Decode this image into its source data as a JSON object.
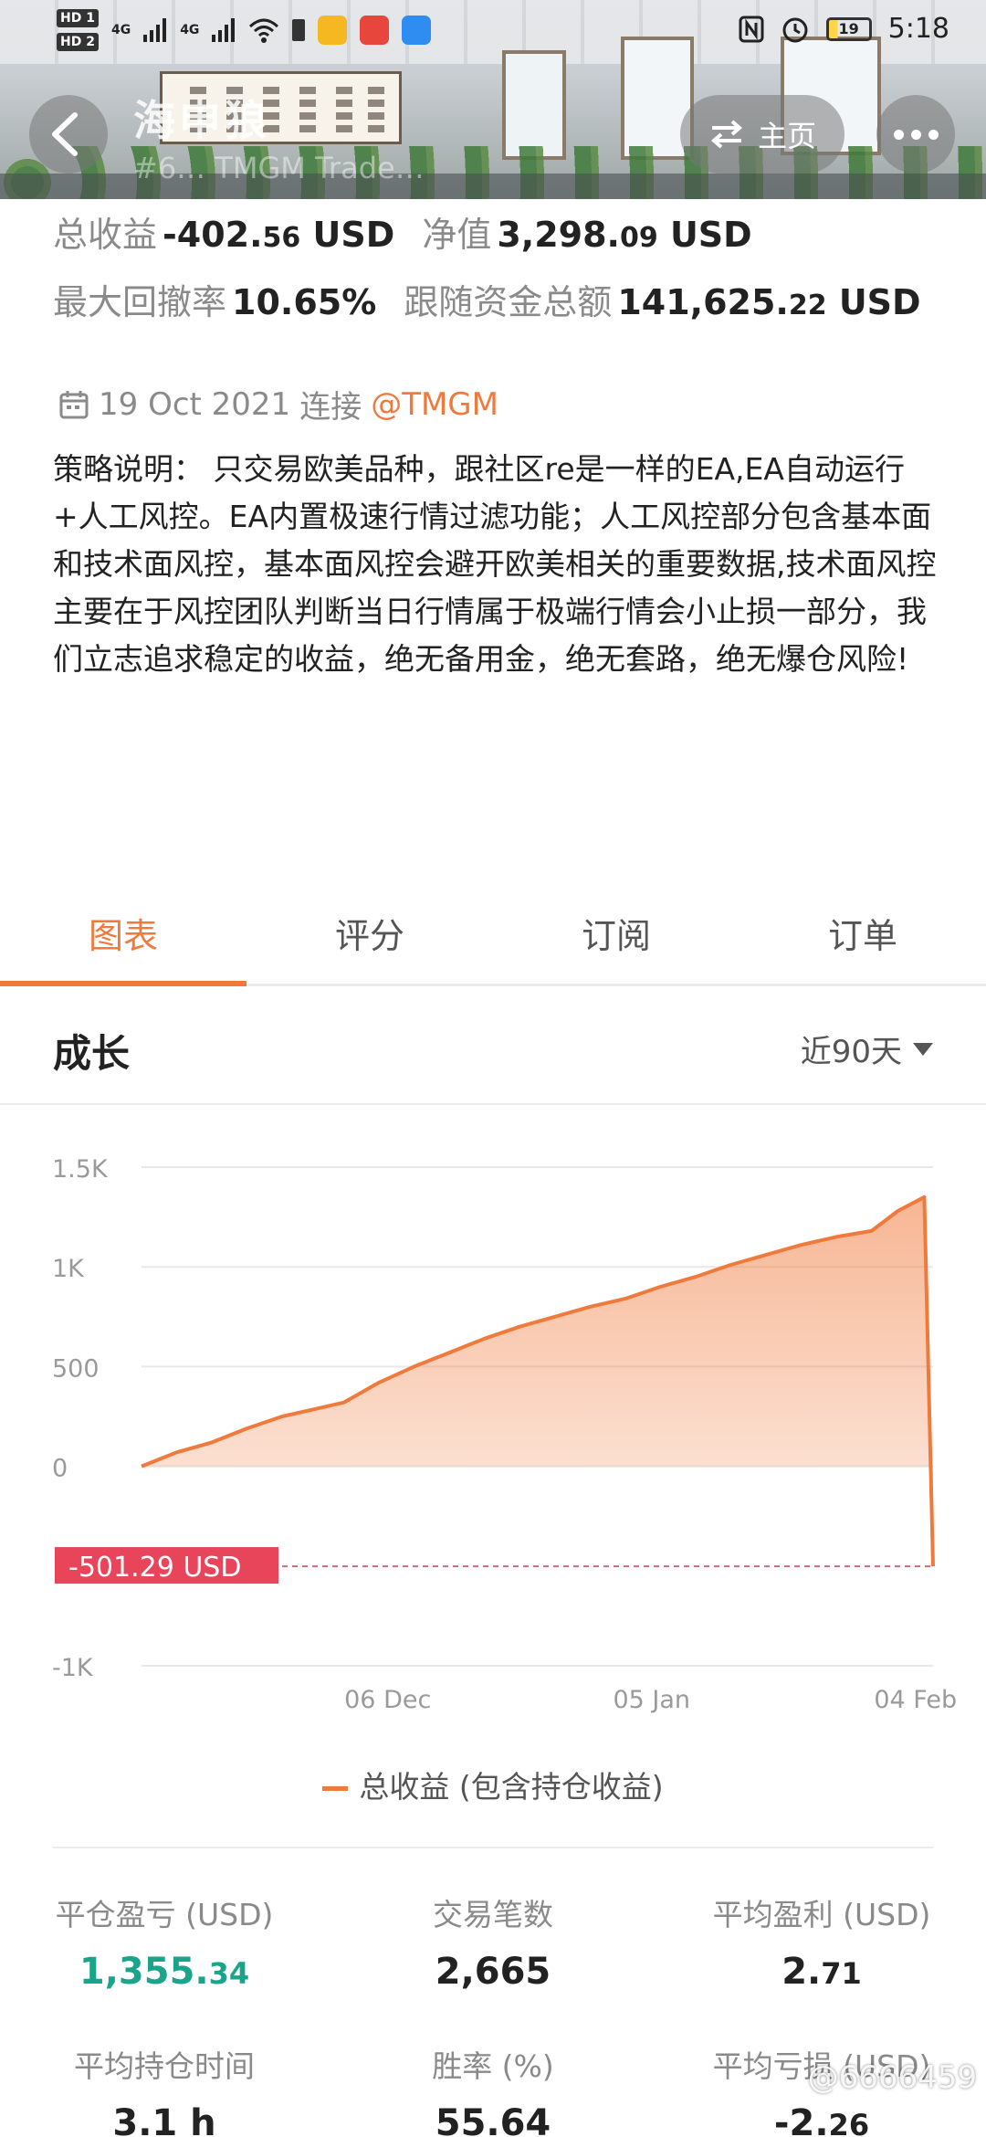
{
  "status_bar": {
    "hd1": "HD 1",
    "hd2": "HD 2",
    "sig1": "4G",
    "sig2": "4G",
    "battery": "19",
    "time": "5:18"
  },
  "header": {
    "title": "海申狼",
    "subtitle": "#6… TMGM Trade…",
    "home_label": "主页"
  },
  "metrics": {
    "total_profit_label": "总收益",
    "total_profit_int": "-402.",
    "total_profit_dec": "56",
    "total_profit_unit": "USD",
    "equity_label": "净值",
    "equity_int": "3,298.",
    "equity_dec": "09",
    "equity_unit": "USD",
    "drawdown_label": "最大回撤率",
    "drawdown_value": "10.65%",
    "follow_label": "跟随资金总额",
    "follow_int": "141,625.",
    "follow_dec": "22",
    "follow_unit": "USD"
  },
  "info": {
    "date": "19 Oct 2021",
    "connect_label": "连接",
    "broker": "@TMGM",
    "description": "策略说明： 只交易欧美品种，跟社区re是一样的EA,EA自动运行+人工风控。EA内置极速行情过滤功能；人工风控部分包含基本面和技术面风控，基本面风控会避开欧美相关的重要数据,技术面风控主要在于风控团队判断当日行情属于极端行情会小止损一部分，我们立志追求稳定的收益，绝无备用金，绝无套路，绝无爆仓风险!"
  },
  "tabs": [
    {
      "label": "图表"
    },
    {
      "label": "评分"
    },
    {
      "label": "订阅"
    },
    {
      "label": "订单"
    }
  ],
  "section": {
    "title": "成长",
    "period": "近90天"
  },
  "chart_data": {
    "type": "area",
    "title": "",
    "xlabel": "",
    "ylabel": "",
    "ylim": [
      -1000,
      1500
    ],
    "y_ticks": [
      "1.5K",
      "1K",
      "500",
      "0",
      "-1K"
    ],
    "y_tick_values": [
      1500,
      1000,
      500,
      0,
      -1000
    ],
    "x_ticks": [
      "06 Dec",
      "05 Jan",
      "04 Feb"
    ],
    "x_tick_values": [
      "2021-12-06",
      "2022-01-05",
      "2022-02-04"
    ],
    "grid": true,
    "legend_position": "bottom",
    "series": [
      {
        "name": "总收益 (包含持仓收益)",
        "color": "#f07a3c",
        "x": [
          "2021-11-08",
          "2021-11-12",
          "2021-11-16",
          "2021-11-20",
          "2021-11-24",
          "2021-11-28",
          "2021-12-01",
          "2021-12-05",
          "2021-12-09",
          "2021-12-13",
          "2021-12-17",
          "2021-12-21",
          "2021-12-25",
          "2021-12-29",
          "2022-01-02",
          "2022-01-06",
          "2022-01-10",
          "2022-01-14",
          "2022-01-18",
          "2022-01-22",
          "2022-01-26",
          "2022-01-30",
          "2022-02-02",
          "2022-02-05",
          "2022-02-06"
        ],
        "values": [
          0,
          70,
          120,
          190,
          250,
          290,
          320,
          420,
          500,
          570,
          640,
          700,
          750,
          800,
          840,
          900,
          950,
          1010,
          1060,
          1110,
          1150,
          1180,
          1280,
          1350,
          -501.29
        ]
      }
    ],
    "annotations": [
      {
        "label": "-501.29 USD",
        "value": -501.29
      }
    ]
  },
  "stats": {
    "closed_pl_label": "平仓盈亏 (USD)",
    "closed_pl_int": "1,355.",
    "closed_pl_dec": "34",
    "trades_label": "交易笔数",
    "trades_value": "2,665",
    "avg_profit_label": "平均盈利 (USD)",
    "avg_profit_int": "2.",
    "avg_profit_dec": "71",
    "avg_hold_label": "平均持仓时间",
    "avg_hold_value": "3.1 h",
    "winrate_label": "胜率 (%)",
    "winrate_value": "55.64",
    "avg_loss_label": "平均亏损 (USD)",
    "avg_loss_int": "-2.",
    "avg_loss_dec": "26"
  },
  "watermark": "@6666459",
  "colors": {
    "accent": "#f07a3c",
    "positive": "#1aa58b",
    "negative_marker": "#e8455a"
  }
}
